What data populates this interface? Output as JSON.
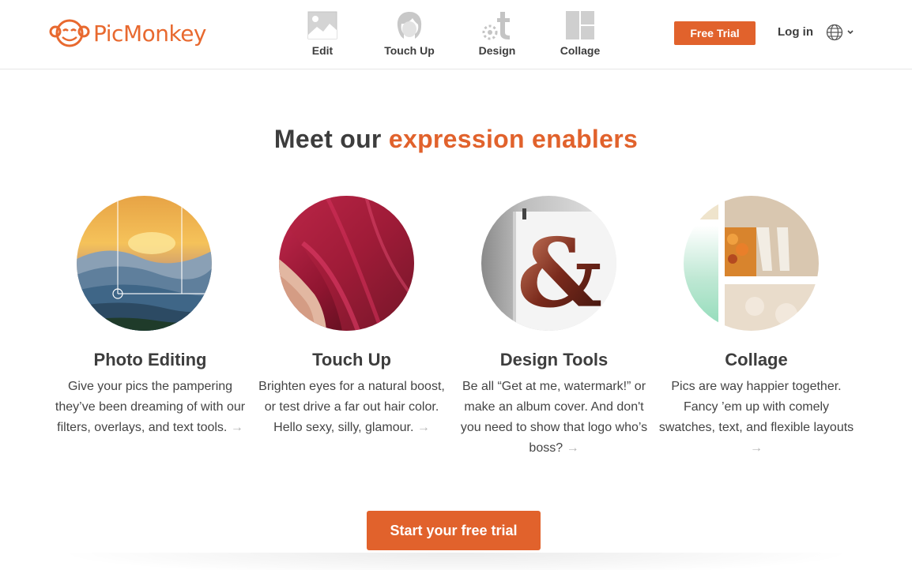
{
  "brand": {
    "logo_text": "PicMonkey",
    "accent_color": "#e1622c"
  },
  "nav": {
    "items": [
      {
        "label": "Edit",
        "icon": "image-icon"
      },
      {
        "label": "Touch Up",
        "icon": "face-icon"
      },
      {
        "label": "Design",
        "icon": "design-icon"
      },
      {
        "label": "Collage",
        "icon": "collage-icon"
      }
    ]
  },
  "header": {
    "free_trial_label": "Free Trial",
    "login_label": "Log in",
    "language_icon": "globe-icon"
  },
  "headline": {
    "prefix": "Meet our",
    "accent": "expression enablers"
  },
  "features": [
    {
      "title": "Photo Editing",
      "description": "Give your pics the pampering they’ve been dreaming of with our filters, overlays, and text tools.",
      "arrow": "→"
    },
    {
      "title": "Touch Up",
      "description": "Brighten eyes for a natural boost, or test drive a far out hair color. Hello sexy, silly, glamour.",
      "arrow": "→"
    },
    {
      "title": "Design Tools",
      "description": "Be all “Get at me, watermark!” or make an album cover. And don't you need to show that logo who’s boss?",
      "arrow": "→"
    },
    {
      "title": "Collage",
      "description": "Pics are way happier together. Fancy ’em up with comely swatches, text, and flexible layouts",
      "arrow": "→"
    }
  ],
  "cta": {
    "label": "Start your free trial"
  }
}
